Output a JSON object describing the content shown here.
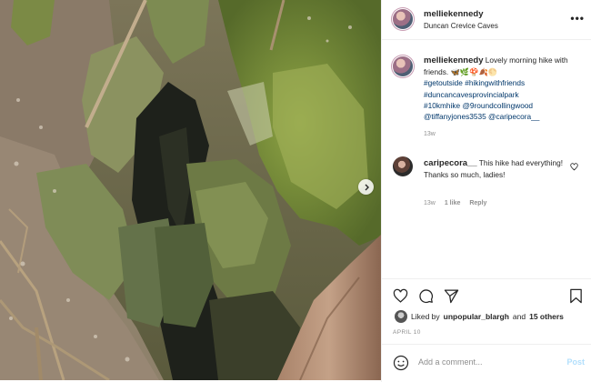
{
  "post": {
    "author": "melliekennedy",
    "location": "Duncan Crevice Caves",
    "caption": {
      "text": "Lovely morning hike with friends.",
      "emojis": "🦋🌿🍄🍂🌕",
      "tags": [
        "#getoutside",
        "#hikingwithfriends",
        "#duncancavesprovincialpark",
        "#10kmhike"
      ],
      "mentions": [
        "@9roundcollingwood",
        "@tiffanyjones3535",
        "@caripecora__"
      ],
      "age": "13w"
    },
    "comments": [
      {
        "author": "caripecora__",
        "text": "This hike had everything! Thanks so much, ladies!",
        "age": "13w",
        "likes": "1 like",
        "reply_label": "Reply"
      }
    ],
    "liked_by": {
      "prefix": "Liked by",
      "user": "unpopular_blargh",
      "joiner": "and",
      "others": "15 others"
    },
    "date": "APRIL 10",
    "add_comment": {
      "placeholder": "Add a comment...",
      "post_label": "Post"
    }
  },
  "icons": {
    "more": "more-options-icon",
    "carousel": "chevron-right-icon",
    "like": "heart-icon",
    "comment": "comment-icon",
    "share": "paper-plane-icon",
    "save": "bookmark-icon",
    "emoji": "smiley-icon"
  },
  "colors": {
    "link": "#00376b",
    "muted": "#8e8e8e",
    "post_button_disabled": "#b2dffc"
  }
}
